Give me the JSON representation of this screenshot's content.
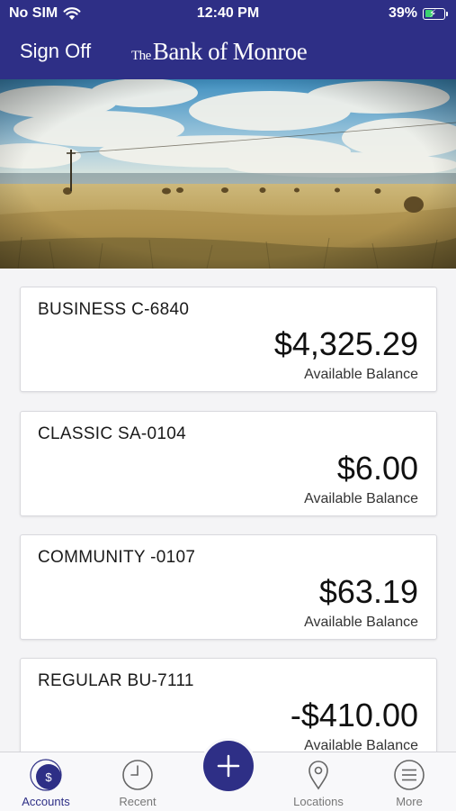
{
  "status_bar": {
    "carrier": "No SIM",
    "time": "12:40 PM",
    "battery": "39%",
    "battery_level": 0.39
  },
  "header": {
    "sign_off_label": "Sign Off",
    "brand_prefix": "The",
    "brand_name": "Bank of Monroe",
    "color": "#2e2f86"
  },
  "accounts": [
    {
      "name": "BUSINESS C-6840",
      "amount": "$4,325.29",
      "balance_label": "Available Balance"
    },
    {
      "name": "CLASSIC SA-0104",
      "amount": "$6.00",
      "balance_label": "Available Balance"
    },
    {
      "name": "COMMUNITY -0107",
      "amount": "$63.19",
      "balance_label": "Available Balance"
    },
    {
      "name": "REGULAR BU-7111",
      "amount": "-$410.00",
      "balance_label": "Available Balance"
    }
  ],
  "tabbar": {
    "items": [
      {
        "label": "Accounts",
        "icon": "accounts-dollar-icon",
        "active": true
      },
      {
        "label": "Recent",
        "icon": "clock-icon",
        "active": false
      },
      {
        "label": "",
        "icon": "plus-icon",
        "active": false
      },
      {
        "label": "Locations",
        "icon": "location-pin-icon",
        "active": false
      },
      {
        "label": "More",
        "icon": "menu-lines-icon",
        "active": false
      }
    ]
  }
}
